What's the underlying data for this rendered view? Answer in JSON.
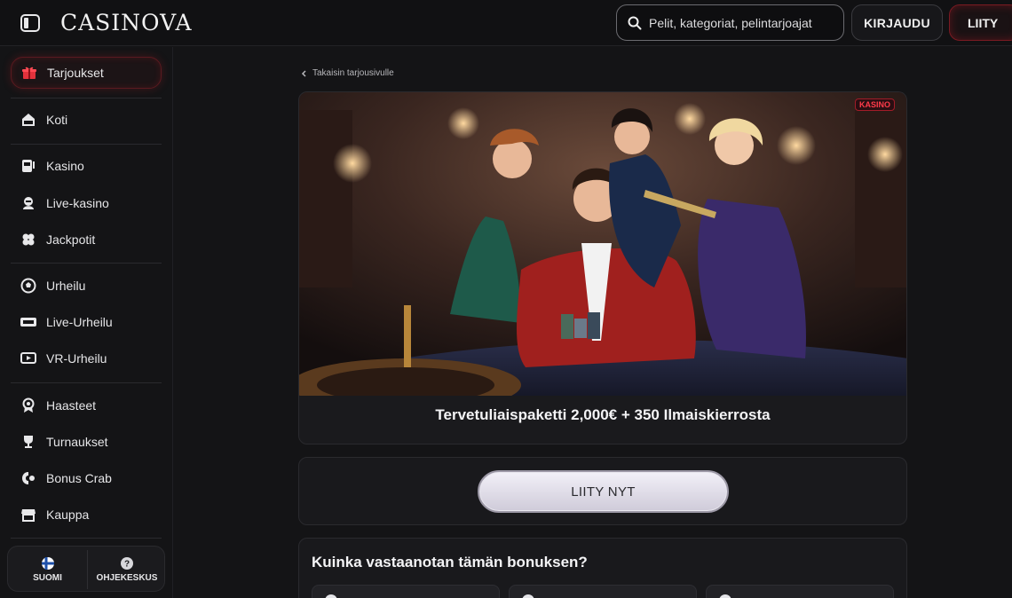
{
  "header": {
    "logo_text": "CASINOVA",
    "search_placeholder": "Pelit, kategoriat, pelintarjoajat",
    "login_label": "KIRJAUDU",
    "join_label": "LIITY"
  },
  "sidebar": {
    "items": [
      {
        "label": "Tarjoukset",
        "icon": "gift-icon",
        "active": true
      },
      {
        "label": "Koti",
        "icon": "home-icon"
      },
      {
        "label": "Kasino",
        "icon": "slot-machine-icon"
      },
      {
        "label": "Live-kasino",
        "icon": "dealer-icon"
      },
      {
        "label": "Jackpotit",
        "icon": "clover-icon"
      },
      {
        "label": "Urheilu",
        "icon": "soccer-ball-icon"
      },
      {
        "label": "Live-Urheilu",
        "icon": "live-badge-icon"
      },
      {
        "label": "VR-Urheilu",
        "icon": "vr-screen-icon"
      },
      {
        "label": "Haasteet",
        "icon": "medal-icon"
      },
      {
        "label": "Turnaukset",
        "icon": "trophy-icon"
      },
      {
        "label": "Bonus Crab",
        "icon": "claw-icon"
      },
      {
        "label": "Kauppa",
        "icon": "shop-icon"
      }
    ],
    "language_label": "SUOMI",
    "help_label": "OHJEKESKUS"
  },
  "main": {
    "back_link": "Takaisin tarjousivulle",
    "badge": "KASINO",
    "promo_title": "Tervetuliaispaketti 2,000€ + 350 Ilmaiskierrosta",
    "cta_label": "LIITY NYT",
    "howto_title": "Kuinka vastaanotan tämän bonuksen?"
  },
  "colors": {
    "accent_red": "#c81e28",
    "background": "#141416"
  }
}
